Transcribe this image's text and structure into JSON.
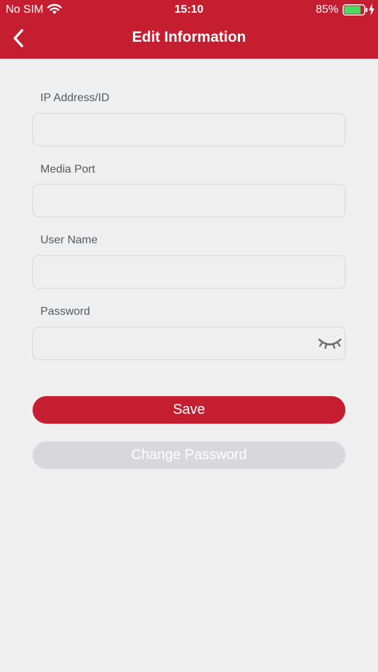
{
  "status_bar": {
    "carrier": "No SIM",
    "time": "15:10",
    "battery_percent": "85%",
    "battery_level": 0.85,
    "icons": [
      "wifi-icon",
      "battery-icon",
      "charging-bolt-icon"
    ]
  },
  "nav": {
    "title": "Edit Information",
    "back_icon": "chevron-left-icon"
  },
  "fields": [
    {
      "label": "IP Address/ID",
      "value": "",
      "placeholder": ""
    },
    {
      "label": "Media Port",
      "value": "",
      "placeholder": ""
    },
    {
      "label": "User Name",
      "value": "",
      "placeholder": ""
    },
    {
      "label": "Password",
      "value": "",
      "placeholder": "",
      "toggle_icon": "eye-closed-icon"
    }
  ],
  "buttons": {
    "save": "Save",
    "change_password": "Change Password"
  },
  "colors": {
    "accent": "#c41e30",
    "background": "#efefef",
    "disabled_button": "#d8d8dc",
    "battery_green": "#4cd964"
  }
}
